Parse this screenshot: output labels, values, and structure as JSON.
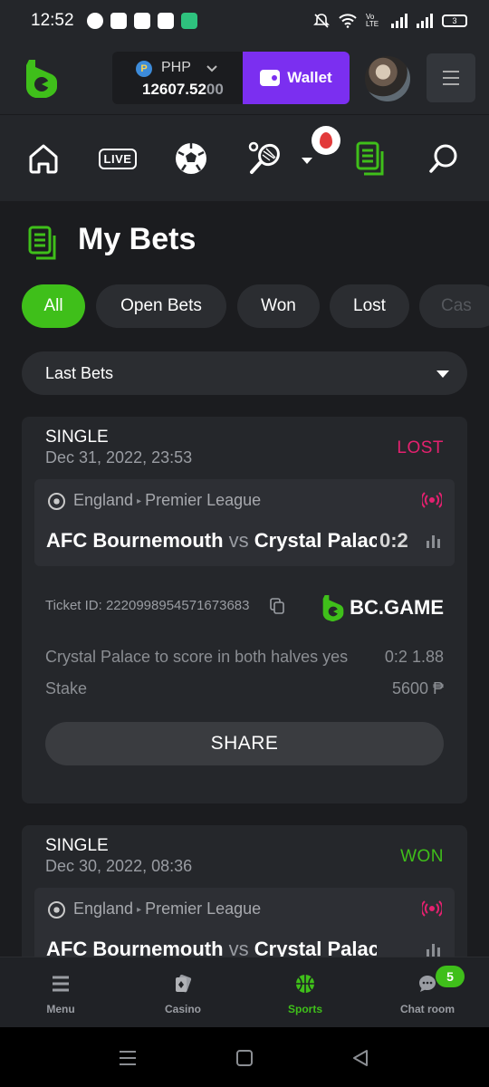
{
  "status_bar": {
    "time": "12:52",
    "battery": "3",
    "network_label": "Vo LTE"
  },
  "header": {
    "currency": "PHP",
    "coin_symbol": "P",
    "balance_main": "12607.52",
    "balance_faded": "00",
    "wallet_label": "Wallet"
  },
  "sport_nav": {
    "live_label": "LIVE"
  },
  "page": {
    "title": "My Bets"
  },
  "filters": {
    "chips": [
      "All",
      "Open Bets",
      "Won",
      "Lost",
      "Cas"
    ],
    "active": "All"
  },
  "period_select": {
    "value": "Last Bets"
  },
  "bets": [
    {
      "type": "SINGLE",
      "date": "Dec 31, 2022, 23:53",
      "status": "LOST",
      "country": "England",
      "league": "Premier League",
      "home": "AFC Bournemouth",
      "vs": "vs",
      "away": "Crystal Palace",
      "score": "0:2",
      "ticket_label": "Ticket ID:",
      "ticket_id": "2220998954571673683",
      "brand": "BC.GAME",
      "selection": "Crystal Palace to score in both halves yes",
      "selection_score": "0:2",
      "odds": "1.88",
      "stake_label": "Stake",
      "stake_value": "5600 ₱",
      "share_label": "SHARE"
    },
    {
      "type": "SINGLE",
      "date": "Dec 30, 2022, 08:36",
      "status": "WON",
      "country": "England",
      "league": "Premier League",
      "home": "AFC Bournemouth",
      "vs": "vs",
      "away": "Crystal Palace"
    }
  ],
  "bottom_nav": {
    "items": [
      "Menu",
      "Casino",
      "Sports",
      "Chat room"
    ],
    "active": "Sports",
    "chat_badge": "5"
  },
  "colors": {
    "accent_green": "#3fbf1a",
    "wallet_purple": "#7b2ff0",
    "lost_pink": "#e4216f"
  }
}
